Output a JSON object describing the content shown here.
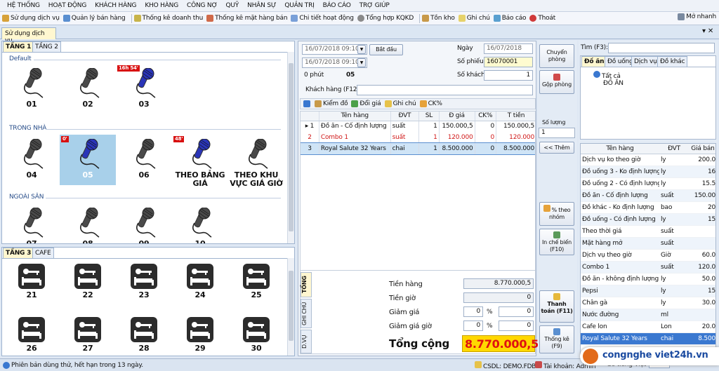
{
  "menu": [
    "HỆ THỐNG",
    "HOẠT ĐỘNG",
    "KHÁCH HÀNG",
    "KHO HÀNG",
    "CÔNG NỢ",
    "QUỸ",
    "NHÂN SỰ",
    "QUẢN TRỊ",
    "BÁO CÁO",
    "TRỢ GIÚP"
  ],
  "toolbar": {
    "items": [
      "Sử dụng dịch vụ",
      "Quản lý bán hàng",
      "Thống kê doanh thu",
      "Thống kê mặt hàng bán",
      "Chi tiết hoạt động",
      "Tổng hợp KQKD",
      "Tồn kho",
      "Ghi chú",
      "Báo cáo",
      "Thoát"
    ],
    "quick": "Mở nhanh"
  },
  "main_tab": "Sử dụng dịch vụ",
  "top_panel": {
    "tabs": [
      "TẦNG 1",
      "TẦNG 2"
    ],
    "groups": [
      "Default",
      "TRONG NHÀ",
      "NGOÀI SÂN"
    ],
    "default_tiles": [
      {
        "label": "01"
      },
      {
        "label": "02"
      },
      {
        "label": "03",
        "badge": "16h 54'"
      }
    ],
    "indoor_tiles": [
      {
        "label": "04"
      },
      {
        "label": "05",
        "badge": "0'"
      },
      {
        "label": "06"
      },
      {
        "label": "THEO BẢNG GIÁ",
        "badge": "48'"
      },
      {
        "label": "THEO KHU VỰC GIÁ GIỜ"
      }
    ],
    "outdoor_tiles": [
      {
        "label": "07"
      },
      {
        "label": "08"
      },
      {
        "label": "09"
      },
      {
        "label": "10"
      }
    ]
  },
  "bottom_panel": {
    "tabs": [
      "TẦNG 3",
      "CAFE"
    ],
    "row1": [
      "21",
      "22",
      "23",
      "24",
      "25"
    ],
    "row2": [
      "26",
      "27",
      "28",
      "29",
      "30"
    ]
  },
  "session": {
    "start_time": "16/07/2018 09:10",
    "end_time": "16/07/2018 09:10",
    "start_btn": "Bắt đầu",
    "minutes": "0 phút",
    "room": "05",
    "date_label": "Ngày",
    "date": "16/07/2018",
    "ticket_label": "Số phiếu",
    "ticket": "16070001",
    "guests_label": "Số khách",
    "guests": "1",
    "customer_label": "Khách hàng (F12)",
    "customer": ""
  },
  "order_toolbar": [
    "Kiểm đồ",
    "Đổi giá",
    "Ghi chú",
    "CK%"
  ],
  "order_grid": {
    "headers": [
      "",
      "Tên hàng",
      "ĐVT",
      "SL",
      "Đ giá",
      "CK%",
      "T tiền"
    ],
    "rows": [
      {
        "no": "1",
        "name": "Đồ ăn - Cố định lượng",
        "unit": "suất",
        "qty": "1",
        "price": "150.000,5",
        "disc": "0",
        "total": "150.000,5"
      },
      {
        "no": "2",
        "name": "Combo 1",
        "unit": "suất",
        "qty": "1",
        "price": "120.000",
        "disc": "0",
        "total": "120.000"
      },
      {
        "no": "3",
        "name": "Royal Salute 32 Years",
        "unit": "chai",
        "qty": "1",
        "price": "8.500.000",
        "disc": "0",
        "total": "8.500.000"
      }
    ]
  },
  "totals": {
    "vtabs": [
      "TỔNG",
      "GHI CHÚ",
      "D.VỤ"
    ],
    "goods_label": "Tiền hàng",
    "goods": "8.770.000,5",
    "time_label": "Tiền giờ",
    "time": "0",
    "discount_label": "Giảm giá",
    "discount_pct": "0",
    "discount_amt": "0",
    "time_discount_label": "Giảm giá giờ",
    "time_discount_pct": "0",
    "time_discount_amt": "0",
    "pct": "%",
    "grand_label": "Tổng cộng",
    "grand": "8.770.000,5",
    "grand_color": "#ffd800",
    "grand_text_color": "#e01010"
  },
  "actions": {
    "transfer": "Chuyển phòng",
    "merge": "Gộp phòng",
    "qty_label": "Số lượng",
    "qty": "1",
    "add": "<< Thêm",
    "pct_group": "% theo nhóm",
    "print_kitchen": "In chế biến (F10)",
    "pay": "Thanh toán (F11)",
    "stats": "Thống kê (F9)"
  },
  "search": {
    "label": "Tìm (F3):",
    "value": "",
    "tabs": [
      "Đồ ăn",
      "Đồ uống",
      "Dịch vụ",
      "Đồ khác"
    ],
    "tree": [
      "Tất cả",
      "ĐỒ ĂN"
    ]
  },
  "products": {
    "headers": [
      "Tên hàng",
      "ĐVT",
      "Giá bán"
    ],
    "rows": [
      [
        "Dịch vụ ko theo giờ",
        "ly",
        "200.0"
      ],
      [
        "Đồ uống 3 - Ko định lượng",
        "ly",
        "16"
      ],
      [
        "Đồ uống 2 - Có định lượng",
        "ly",
        "15.5"
      ],
      [
        "Đồ ăn - Cố định lượng",
        "suất",
        "150.00"
      ],
      [
        "Đồ khác - Ko định lượng",
        "bao",
        "20"
      ],
      [
        "Đồ uống - Có định lượng",
        "ly",
        "15"
      ],
      [
        "Theo thời giá",
        "suất",
        ""
      ],
      [
        "Mặt hàng mở",
        "suất",
        ""
      ],
      [
        "Dịch vụ theo giờ",
        "Giờ",
        "60.0"
      ],
      [
        "Combo 1",
        "suất",
        "120.0"
      ],
      [
        "Đồ ăn - không định lượng",
        "ly",
        "50.0"
      ],
      [
        "Pepsi",
        "ly",
        "15"
      ],
      [
        "Chân gà",
        "ly",
        "30.0"
      ],
      [
        "Nước đường",
        "ml",
        ""
      ],
      [
        "Cafe lon",
        "Lon",
        "20.0"
      ],
      [
        "Royal Salute 32 Years",
        "chai",
        "8.500"
      ]
    ],
    "selected_index": 15
  },
  "status": {
    "trial": "Phiên bản dùng thử, hết hạn trong 13 ngày.",
    "db": "CSDL: DEMO.FDB",
    "account": "Tài khoản: Admin",
    "font": "Gõ tiếng Việt",
    "ime": "Telex"
  },
  "watermark": "congnghe viet24h.vn"
}
